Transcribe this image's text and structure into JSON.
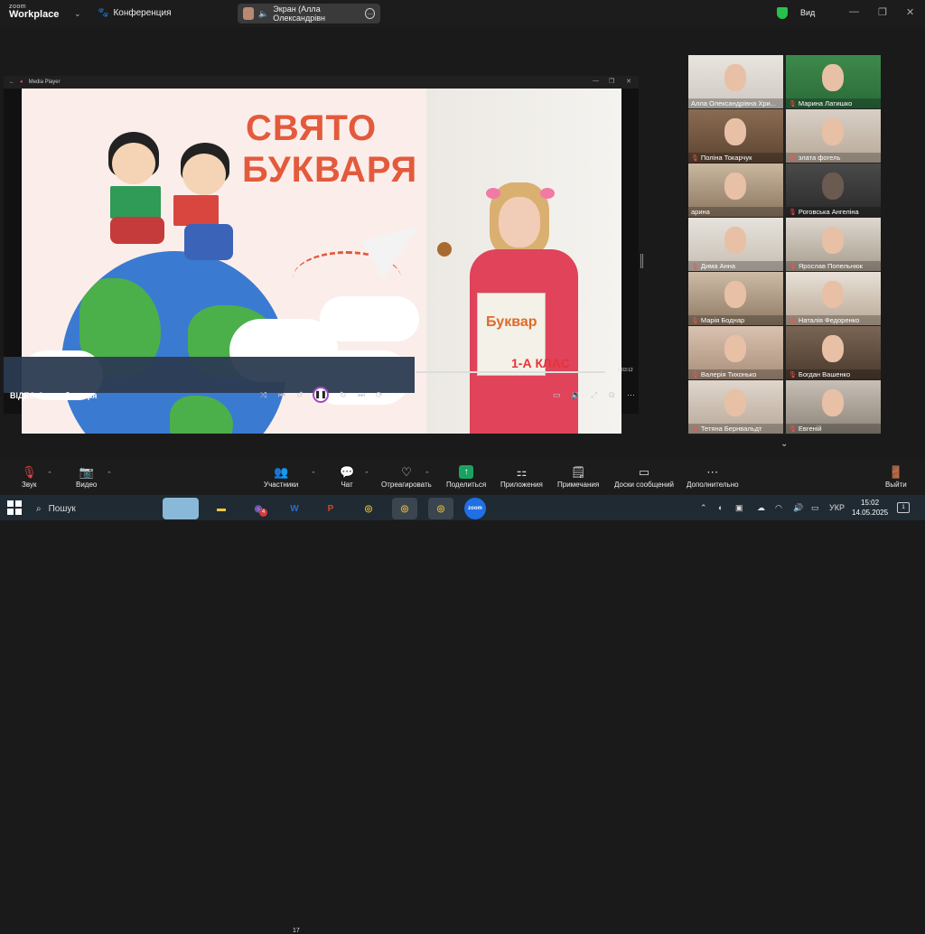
{
  "topbar": {
    "logo_top": "zoom",
    "logo_bottom": "Workplace",
    "meeting_label": "Конференция",
    "share_label": "Экран (Алла Олександрівн",
    "view_label": "Вид"
  },
  "media_player": {
    "title": "Media Player",
    "video_title": "ВІДЕО Свято букваря",
    "time": "0:03:12"
  },
  "slide": {
    "title_line1": "СВЯТО",
    "title_line2": "БУКВАРЯ",
    "book_title": "Буквар",
    "grade_text": "1-А КЛАС"
  },
  "gallery": [
    {
      "name": "Алла Олександрівна Хри...",
      "muted": false
    },
    {
      "name": "Марина Латишко",
      "muted": true
    },
    {
      "name": "Поліна Токарчук",
      "muted": true
    },
    {
      "name": "злата фогель",
      "muted": true
    },
    {
      "name": "арина",
      "muted": false,
      "active": true
    },
    {
      "name": "Роговська Ангеліна",
      "muted": true
    },
    {
      "name": "Дима Анна",
      "muted": true
    },
    {
      "name": "Ярослав Попельнюк",
      "muted": true
    },
    {
      "name": "Марія Боднар",
      "muted": true
    },
    {
      "name": "Наталія Федоренко",
      "muted": true
    },
    {
      "name": "Валерія Тихонько",
      "muted": true
    },
    {
      "name": "Богдан Вашенко",
      "muted": true
    },
    {
      "name": "Тетяна Бернвальдт",
      "muted": true
    },
    {
      "name": "Евгеній",
      "muted": true
    }
  ],
  "toolbar": {
    "audio": "Звук",
    "video": "Видео",
    "participants": "Участники",
    "participants_count": "17",
    "chat": "Чат",
    "react": "Отреагировать",
    "share": "Поделиться",
    "apps": "Приложения",
    "notes": "Примечания",
    "whiteboards": "Доски сообщений",
    "more": "Дополнительно",
    "leave": "Выйти"
  },
  "taskbar": {
    "search_placeholder": "Пошук",
    "lang": "УКР",
    "time": "15:02",
    "date": "14.05.2025",
    "viber_badge": "4",
    "notif_count": "1"
  },
  "colors": {
    "accent_green": "#2bd36a",
    "slide_title": "#e35a3c",
    "mute_red": "#ff4d4d"
  }
}
